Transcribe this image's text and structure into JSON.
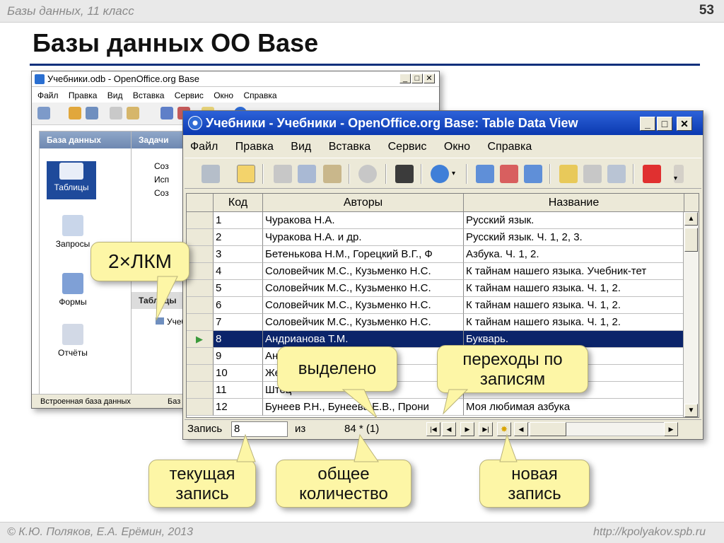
{
  "slide": {
    "course": "Базы данных, 11 класс",
    "page_number": "53",
    "title": "Базы данных OO Base",
    "copyright": "© К.Ю. Поляков, Е.А. Ерёмин, 2013",
    "site": "http://kpolyakov.spb.ru"
  },
  "back_window": {
    "title": "Учебники.odb - OpenOffice.org Base",
    "menu": [
      "Файл",
      "Правка",
      "Вид",
      "Вставка",
      "Сервис",
      "Окно",
      "Справка"
    ],
    "panel_database": "База данных",
    "panel_tasks": "Задачи",
    "panel_tables": "Таблицы",
    "items": [
      "Таблицы",
      "Запросы",
      "Формы",
      "Отчёты"
    ],
    "tasks": [
      "Соз",
      "Исп",
      "Соз"
    ],
    "table_item": "Учеб",
    "status": "Встроенная база данных",
    "status_right": "Баз"
  },
  "front_window": {
    "title": "Учебники - Учебники - OpenOffice.org Base: Table Data View",
    "menu": [
      "Файл",
      "Правка",
      "Вид",
      "Вставка",
      "Сервис",
      "Окно",
      "Справка"
    ],
    "columns": [
      "Код",
      "Авторы",
      "Название"
    ],
    "rows": [
      {
        "id": "1",
        "author": "Чуракова Н.А.",
        "title": "Русский язык."
      },
      {
        "id": "2",
        "author": "Чуракова Н.А. и др.",
        "title": "Русский язык. Ч. 1, 2, 3."
      },
      {
        "id": "3",
        "author": "Бетенькова Н.М., Горецкий В.Г., Ф",
        "title": "Азбука. Ч. 1, 2."
      },
      {
        "id": "4",
        "author": "Соловейчик М.С., Кузьменко Н.С.",
        "title": "К тайнам нашего языка. Учебник-тет"
      },
      {
        "id": "5",
        "author": "Соловейчик М.С., Кузьменко Н.С.",
        "title": "К тайнам нашего языка. Ч. 1, 2."
      },
      {
        "id": "6",
        "author": "Соловейчик М.С., Кузьменко Н.С.",
        "title": "К тайнам нашего языка. Ч. 1, 2."
      },
      {
        "id": "7",
        "author": "Соловейчик М.С., Кузьменко Н.С.",
        "title": "К тайнам нашего языка. Ч. 1, 2."
      },
      {
        "id": "8",
        "author": "Андрианова Т.М.",
        "title": "Букварь."
      },
      {
        "id": "9",
        "author": "Ан",
        "title": ""
      },
      {
        "id": "10",
        "author": "Же",
        "title": ""
      },
      {
        "id": "11",
        "author": "Штец",
        "title": ""
      },
      {
        "id": "12",
        "author": "Бунеев Р.Н., Бунеева Е.В., Прони",
        "title": "Моя любимая азбука"
      }
    ],
    "navbar": {
      "record_label": "Запись",
      "current": "8",
      "of_label": "из",
      "total": "84 * (1)"
    }
  },
  "callouts": {
    "double_click": "2×ЛКМ",
    "selected": "выделено",
    "navigation": "переходы по записям",
    "current_record": "текущая запись",
    "total_count": "общее количество",
    "new_record": "новая запись"
  },
  "colors": {
    "title_rule": "#0c2f7c",
    "callout_fill": "#fdf6a6",
    "selected_row": "#0b246a"
  }
}
